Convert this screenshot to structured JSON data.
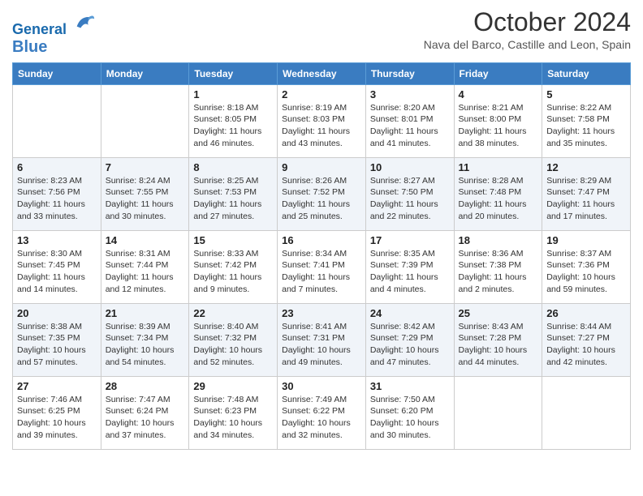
{
  "header": {
    "logo_line1": "General",
    "logo_line2": "Blue",
    "title": "October 2024",
    "location": "Nava del Barco, Castille and Leon, Spain"
  },
  "days_of_week": [
    "Sunday",
    "Monday",
    "Tuesday",
    "Wednesday",
    "Thursday",
    "Friday",
    "Saturday"
  ],
  "weeks": [
    [
      {
        "day": "",
        "info": ""
      },
      {
        "day": "",
        "info": ""
      },
      {
        "day": "1",
        "info": "Sunrise: 8:18 AM\nSunset: 8:05 PM\nDaylight: 11 hours and 46 minutes."
      },
      {
        "day": "2",
        "info": "Sunrise: 8:19 AM\nSunset: 8:03 PM\nDaylight: 11 hours and 43 minutes."
      },
      {
        "day": "3",
        "info": "Sunrise: 8:20 AM\nSunset: 8:01 PM\nDaylight: 11 hours and 41 minutes."
      },
      {
        "day": "4",
        "info": "Sunrise: 8:21 AM\nSunset: 8:00 PM\nDaylight: 11 hours and 38 minutes."
      },
      {
        "day": "5",
        "info": "Sunrise: 8:22 AM\nSunset: 7:58 PM\nDaylight: 11 hours and 35 minutes."
      }
    ],
    [
      {
        "day": "6",
        "info": "Sunrise: 8:23 AM\nSunset: 7:56 PM\nDaylight: 11 hours and 33 minutes."
      },
      {
        "day": "7",
        "info": "Sunrise: 8:24 AM\nSunset: 7:55 PM\nDaylight: 11 hours and 30 minutes."
      },
      {
        "day": "8",
        "info": "Sunrise: 8:25 AM\nSunset: 7:53 PM\nDaylight: 11 hours and 27 minutes."
      },
      {
        "day": "9",
        "info": "Sunrise: 8:26 AM\nSunset: 7:52 PM\nDaylight: 11 hours and 25 minutes."
      },
      {
        "day": "10",
        "info": "Sunrise: 8:27 AM\nSunset: 7:50 PM\nDaylight: 11 hours and 22 minutes."
      },
      {
        "day": "11",
        "info": "Sunrise: 8:28 AM\nSunset: 7:48 PM\nDaylight: 11 hours and 20 minutes."
      },
      {
        "day": "12",
        "info": "Sunrise: 8:29 AM\nSunset: 7:47 PM\nDaylight: 11 hours and 17 minutes."
      }
    ],
    [
      {
        "day": "13",
        "info": "Sunrise: 8:30 AM\nSunset: 7:45 PM\nDaylight: 11 hours and 14 minutes."
      },
      {
        "day": "14",
        "info": "Sunrise: 8:31 AM\nSunset: 7:44 PM\nDaylight: 11 hours and 12 minutes."
      },
      {
        "day": "15",
        "info": "Sunrise: 8:33 AM\nSunset: 7:42 PM\nDaylight: 11 hours and 9 minutes."
      },
      {
        "day": "16",
        "info": "Sunrise: 8:34 AM\nSunset: 7:41 PM\nDaylight: 11 hours and 7 minutes."
      },
      {
        "day": "17",
        "info": "Sunrise: 8:35 AM\nSunset: 7:39 PM\nDaylight: 11 hours and 4 minutes."
      },
      {
        "day": "18",
        "info": "Sunrise: 8:36 AM\nSunset: 7:38 PM\nDaylight: 11 hours and 2 minutes."
      },
      {
        "day": "19",
        "info": "Sunrise: 8:37 AM\nSunset: 7:36 PM\nDaylight: 10 hours and 59 minutes."
      }
    ],
    [
      {
        "day": "20",
        "info": "Sunrise: 8:38 AM\nSunset: 7:35 PM\nDaylight: 10 hours and 57 minutes."
      },
      {
        "day": "21",
        "info": "Sunrise: 8:39 AM\nSunset: 7:34 PM\nDaylight: 10 hours and 54 minutes."
      },
      {
        "day": "22",
        "info": "Sunrise: 8:40 AM\nSunset: 7:32 PM\nDaylight: 10 hours and 52 minutes."
      },
      {
        "day": "23",
        "info": "Sunrise: 8:41 AM\nSunset: 7:31 PM\nDaylight: 10 hours and 49 minutes."
      },
      {
        "day": "24",
        "info": "Sunrise: 8:42 AM\nSunset: 7:29 PM\nDaylight: 10 hours and 47 minutes."
      },
      {
        "day": "25",
        "info": "Sunrise: 8:43 AM\nSunset: 7:28 PM\nDaylight: 10 hours and 44 minutes."
      },
      {
        "day": "26",
        "info": "Sunrise: 8:44 AM\nSunset: 7:27 PM\nDaylight: 10 hours and 42 minutes."
      }
    ],
    [
      {
        "day": "27",
        "info": "Sunrise: 7:46 AM\nSunset: 6:25 PM\nDaylight: 10 hours and 39 minutes."
      },
      {
        "day": "28",
        "info": "Sunrise: 7:47 AM\nSunset: 6:24 PM\nDaylight: 10 hours and 37 minutes."
      },
      {
        "day": "29",
        "info": "Sunrise: 7:48 AM\nSunset: 6:23 PM\nDaylight: 10 hours and 34 minutes."
      },
      {
        "day": "30",
        "info": "Sunrise: 7:49 AM\nSunset: 6:22 PM\nDaylight: 10 hours and 32 minutes."
      },
      {
        "day": "31",
        "info": "Sunrise: 7:50 AM\nSunset: 6:20 PM\nDaylight: 10 hours and 30 minutes."
      },
      {
        "day": "",
        "info": ""
      },
      {
        "day": "",
        "info": ""
      }
    ]
  ]
}
